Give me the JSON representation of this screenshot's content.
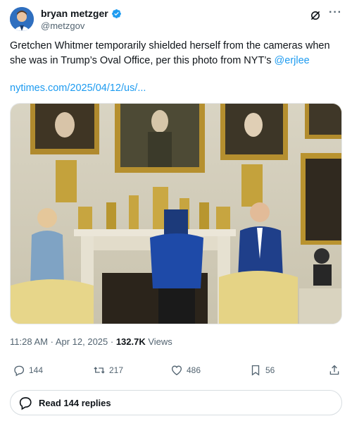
{
  "author": {
    "display_name": "bryan metzger",
    "handle": "@metzgov"
  },
  "tweet": {
    "text_prefix": "Gretchen Whitmer temporarily shielded herself from the cameras when she was in Trump’s Oval Office, per this photo from NYT’s ",
    "mention": "@erjlee",
    "link": "nytimes.com/2025/04/12/us/..."
  },
  "meta": {
    "time": "11:28 AM",
    "sep1": " · ",
    "date": "Apr 12, 2025",
    "sep2": " · ",
    "views_count": "132.7K",
    "views_label": " Views"
  },
  "actions": {
    "reply_count": "144",
    "retweet_count": "217",
    "like_count": "486",
    "bookmark_count": "56"
  },
  "read_replies_label": "Read 144 replies",
  "colors": {
    "accent": "#1d9bf0",
    "text": "#0f1419",
    "muted": "#536471"
  }
}
